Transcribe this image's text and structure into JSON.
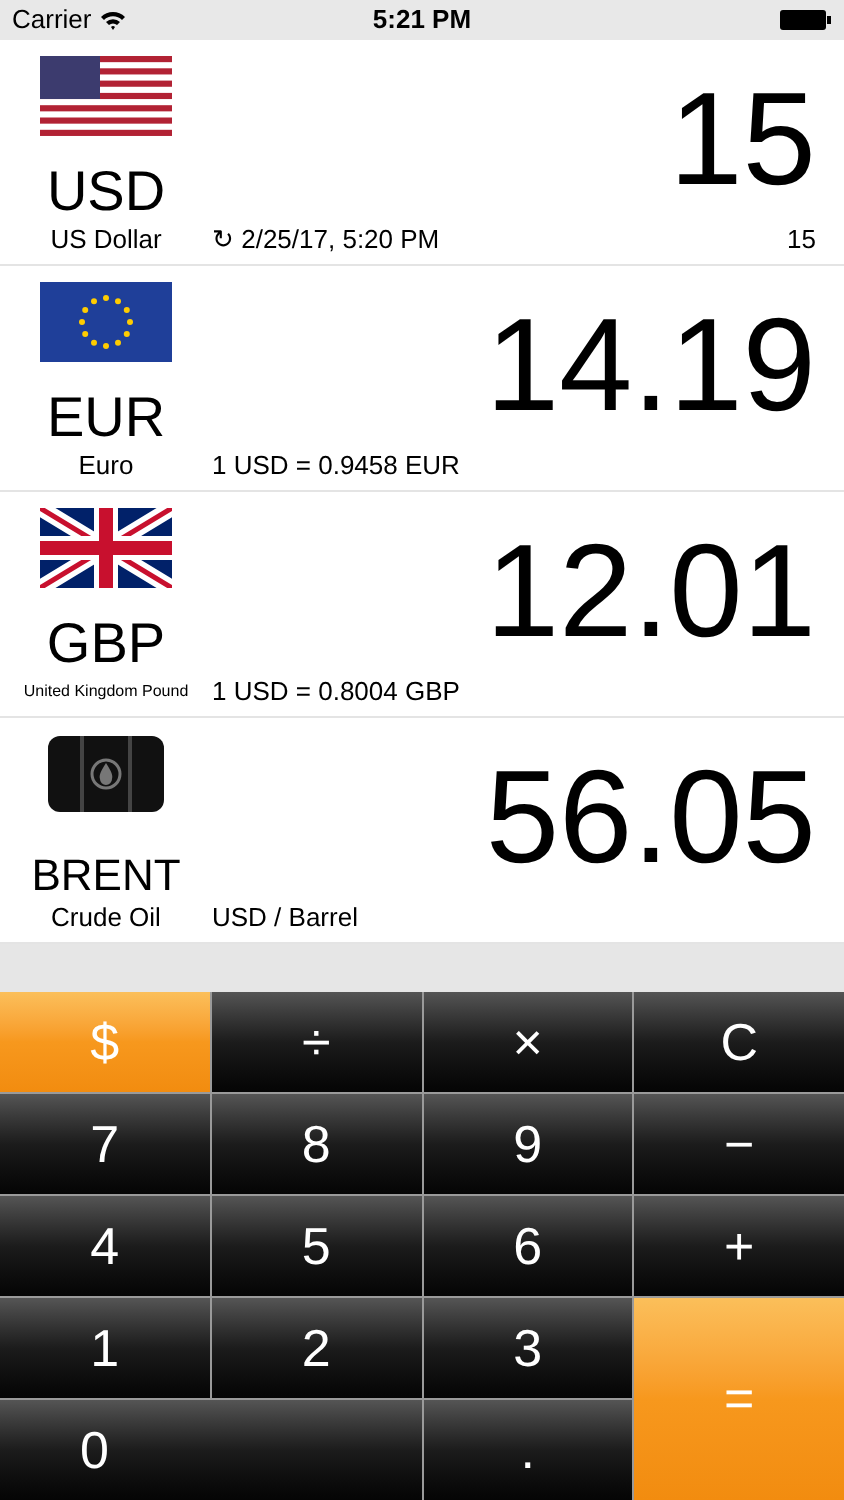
{
  "status_bar": {
    "carrier": "Carrier",
    "time": "5:21 PM"
  },
  "rates": [
    {
      "code": "USD",
      "name": "US Dollar",
      "info": "↻ 2/25/17, 5:20 PM",
      "amount": "15",
      "input": "15"
    },
    {
      "code": "EUR",
      "name": "Euro",
      "info": "1 USD = 0.9458 EUR",
      "amount": "14.19"
    },
    {
      "code": "GBP",
      "name": "United Kingdom Pound",
      "info": "1 USD = 0.8004 GBP",
      "amount": "12.01"
    },
    {
      "code": "BRENT",
      "name": "Crude Oil",
      "info": "USD / Barrel",
      "amount": "56.05"
    }
  ],
  "keypad": [
    {
      "label": "$",
      "kind": "mode",
      "selected": true
    },
    {
      "label": "÷",
      "kind": "key"
    },
    {
      "label": "×",
      "kind": "key"
    },
    {
      "label": "C",
      "kind": "key"
    },
    {
      "label": "7",
      "kind": "key"
    },
    {
      "label": "8",
      "kind": "key"
    },
    {
      "label": "9",
      "kind": "key"
    },
    {
      "label": "−",
      "kind": "key"
    },
    {
      "label": "4",
      "kind": "key"
    },
    {
      "label": "5",
      "kind": "key"
    },
    {
      "label": "6",
      "kind": "key"
    },
    {
      "label": "+",
      "kind": "key"
    },
    {
      "label": "1",
      "kind": "key"
    },
    {
      "label": "2",
      "kind": "key"
    },
    {
      "label": "3",
      "kind": "key"
    },
    {
      "label": "=",
      "kind": "equals"
    },
    {
      "label": "0",
      "kind": "wide"
    },
    {
      "label": ".",
      "kind": "key"
    }
  ]
}
